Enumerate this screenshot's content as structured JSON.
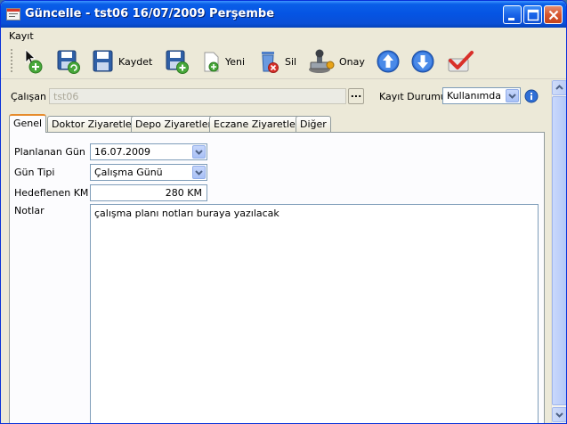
{
  "window": {
    "title": "Güncelle - tst06 16/07/2009 Perşembe",
    "icons": {
      "app": "window-icon",
      "minimize": "minimize-icon",
      "maximize": "maximize-icon",
      "close": "close-icon"
    }
  },
  "menu": {
    "items": [
      {
        "label": "Kayıt"
      }
    ]
  },
  "toolbar": {
    "items": [
      {
        "name": "new-arrow-button",
        "label": "",
        "icon": "cursor-plus-icon"
      },
      {
        "name": "save-refresh-button",
        "label": "",
        "icon": "floppy-refresh-icon"
      },
      {
        "name": "save-button",
        "label": "Kaydet",
        "icon": "floppy-icon"
      },
      {
        "name": "new-button",
        "label": "Yeni",
        "icon": "floppy-plus-icon"
      },
      {
        "name": "delete-button",
        "label": "Sil",
        "icon": "trash-delete-icon"
      },
      {
        "name": "approve-button",
        "label": "Onay",
        "icon": "stamp-icon"
      },
      {
        "name": "prev-button",
        "label": "",
        "icon": "arrow-up-circle-icon"
      },
      {
        "name": "next-button",
        "label": "",
        "icon": "arrow-down-circle-icon"
      },
      {
        "name": "check-button",
        "label": "",
        "icon": "checkmark-icon"
      }
    ]
  },
  "header": {
    "employee_label": "Çalışan",
    "employee_value": "tst06",
    "status_label": "Kayıt Durumu",
    "status_value": "Kullanımda"
  },
  "tabs": [
    {
      "label": "Genel",
      "active": true
    },
    {
      "label": "Doktor Ziyaretleri",
      "active": false
    },
    {
      "label": "Depo Ziyaretleri",
      "active": false
    },
    {
      "label": "Eczane Ziyaretleri",
      "active": false
    },
    {
      "label": "Diğer",
      "active": false
    }
  ],
  "form": {
    "planned_day_label": "Planlanan Gün",
    "planned_day_value": "16.07.2009",
    "day_type_label": "Gün Tipi",
    "day_type_value": "Çalışma Günü",
    "target_km_label": "Hedeflenen KM",
    "target_km_value": "280 KM",
    "notes_label": "Notlar",
    "notes_value": "çalışma planı notları buraya yazılacak"
  },
  "colors": {
    "titlebar": "#0554e3",
    "tab_accent": "#e68b2c",
    "window_bg": "#ece9d8"
  }
}
